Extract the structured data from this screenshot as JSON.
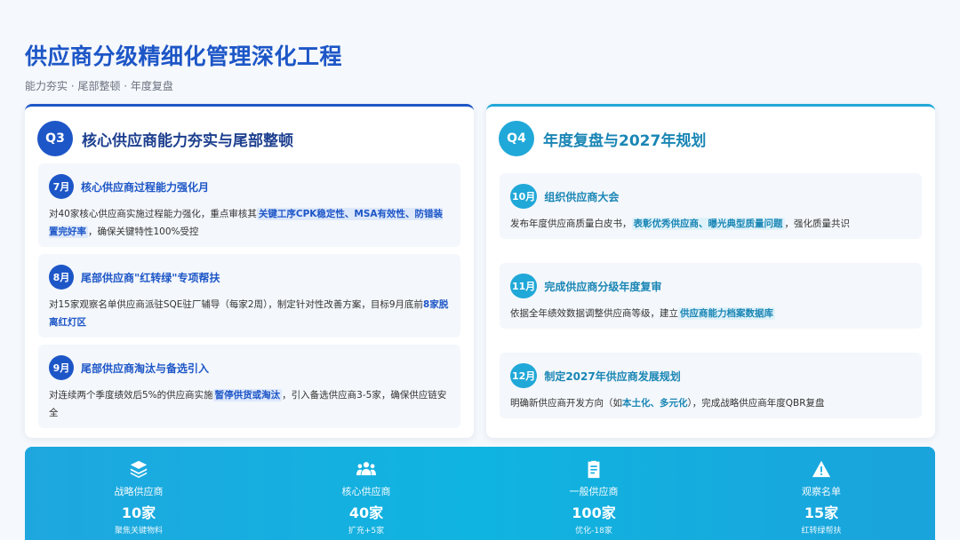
{
  "title": "供应商分级精细化管理深化工程",
  "subtitle": "能力夯实 · 尾部整顿 · 年度复盘",
  "colors": {
    "primary": "#1d56c7",
    "accent": "#20a8d8",
    "banner": "#14aee0"
  },
  "q3": {
    "badge": "Q3",
    "title": "核心供应商能力夯实与尾部整顿",
    "items": [
      {
        "month": "7月",
        "title": "核心供应商过程能力强化月",
        "desc_pre": "对40家核心供应商实施过程能力强化，重点审核其",
        "desc_hl": "关键工序CPK稳定性、MSA有效性、防错装置完好率",
        "desc_post": "，确保关键特性100%受控"
      },
      {
        "month": "8月",
        "title": "尾部供应商\"红转绿\"专项帮扶",
        "desc_pre": "对15家观察名单供应商派驻SQE驻厂辅导（每家2周），制定针对性改善方案，目标9月底前",
        "desc_hl": "8家脱离红灯区",
        "desc_post": ""
      },
      {
        "month": "9月",
        "title": "尾部供应商淘汰与备选引入",
        "desc_pre": "对连续两个季度绩效后5%的供应商实施",
        "desc_hl": "暂停供货或淘汰",
        "desc_post": "，引入备选供应商3-5家，确保供应链安全"
      }
    ]
  },
  "q4": {
    "badge": "Q4",
    "title": "年度复盘与2027年规划",
    "items": [
      {
        "month": "10月",
        "title": "组织供应商大会",
        "desc_pre": "发布年度供应商质量白皮书，",
        "desc_hl": "表彰优秀供应商、曝光典型质量问题",
        "desc_post": "，强化质量共识"
      },
      {
        "month": "11月",
        "title": "完成供应商分级年度复审",
        "desc_pre": "依据全年绩效数据调整供应商等级，建立",
        "desc_hl": "供应商能力档案数据库",
        "desc_post": ""
      },
      {
        "month": "12月",
        "title": "制定2027年供应商发展规划",
        "desc_pre": "明确新供应商开发方向（如",
        "desc_hl": "本土化、多元化",
        "desc_post": "），完成战略供应商年度QBR复盘"
      }
    ]
  },
  "stats": [
    {
      "icon": "layers-icon",
      "label": "战略供应商",
      "value": "10家",
      "note": "聚焦关键物料"
    },
    {
      "icon": "users-icon",
      "label": "核心供应商",
      "value": "40家",
      "note": "扩充+5家"
    },
    {
      "icon": "clipboard-icon",
      "label": "一般供应商",
      "value": "100家",
      "note": "优化-18家"
    },
    {
      "icon": "warning-icon",
      "label": "观察名单",
      "value": "15家",
      "note": "红转绿帮扶"
    }
  ]
}
